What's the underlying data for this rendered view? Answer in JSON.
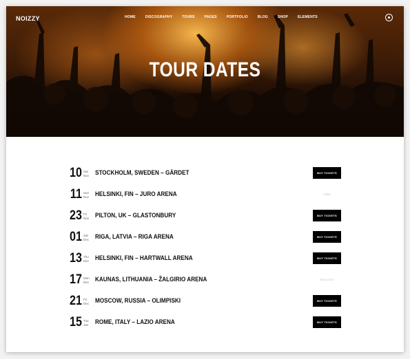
{
  "header": {
    "logo": "NOIZZY",
    "nav": [
      "HOME",
      "DISCOGRAPHY",
      "TOURS",
      "PAGES",
      "PORTFOLIO",
      "BLOG",
      "SHOP",
      "ELEMENTS"
    ]
  },
  "hero": {
    "title": "TOUR DATES"
  },
  "tours": [
    {
      "day": "10",
      "weekday": "Sat",
      "month": "Nov",
      "venue": "STOCKHOLM, SWEDEN – GÄRDET",
      "action": "BUY TICKETS"
    },
    {
      "day": "11",
      "weekday": "Sun",
      "month": "Nov",
      "venue": "HELSINKI, FIN – JURO ARENA",
      "action": "FREE"
    },
    {
      "day": "23",
      "weekday": "Fri",
      "month": "Nov",
      "venue": "PILTON, UK – GLASTONBURY",
      "action": "BUY TICKETS"
    },
    {
      "day": "01",
      "weekday": "Sat",
      "month": "Dec",
      "venue": "RIGA, LATVIA – RIGA ARENA",
      "action": "BUY TICKETS"
    },
    {
      "day": "13",
      "weekday": "Thu",
      "month": "Dec",
      "venue": "HELSINKI, FIN – HARTWALL ARENA",
      "action": "BUY TICKETS"
    },
    {
      "day": "17",
      "weekday": "Mon",
      "month": "Dec",
      "venue": "KAUNAS, LITHUANIA – ŽALGIRIO ARENA",
      "action": "SOLD OUT"
    },
    {
      "day": "21",
      "weekday": "Fri",
      "month": "Dec",
      "venue": "MOSCOW, RUSSIA – OLIMPISKI",
      "action": "BUY TICKETS"
    },
    {
      "day": "15",
      "weekday": "Tue",
      "month": "Jan",
      "venue": "ROME, ITALY – LAZIO ARENA",
      "action": "BUY TICKETS"
    }
  ],
  "colors": {
    "button_bg": "#000000",
    "button_text": "#ffffff",
    "status_text": "#bbbbbb",
    "hero_glow": "#f0a030"
  }
}
